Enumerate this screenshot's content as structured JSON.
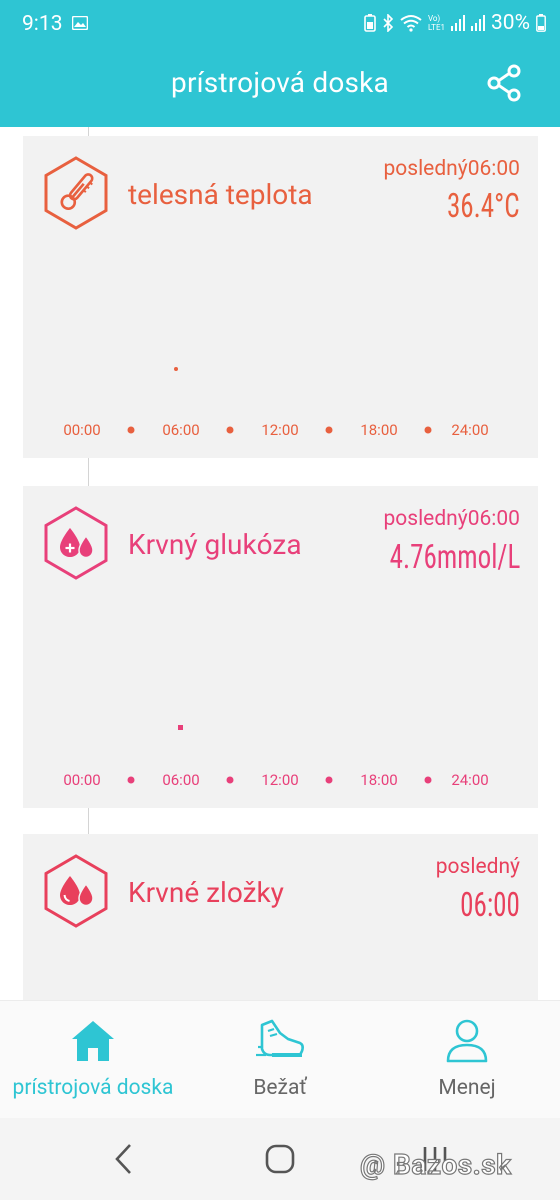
{
  "status": {
    "time": "9:13",
    "battery": "30%",
    "network_label_top": "Vo)",
    "network_label_bottom": "LTE1"
  },
  "appbar": {
    "title": "prístrojová doska",
    "share_icon": "share-icon"
  },
  "cards": [
    {
      "title": "telesná teplota",
      "last_label": "posledný06:00",
      "value": "36.4°C",
      "icon": "thermometer-icon",
      "color": "#e8603f",
      "axis_ticks": [
        "00:00",
        "06:00",
        "12:00",
        "18:00",
        "24:00"
      ]
    },
    {
      "title": "Krvný glukóza",
      "last_label": "posledný06:00",
      "value": "4.76mmol/L",
      "icon": "blood-drops-icon",
      "color": "#e8407a",
      "axis_ticks": [
        "00:00",
        "06:00",
        "12:00",
        "18:00",
        "24:00"
      ]
    },
    {
      "title": "Krvné zložky",
      "last_label": "posledný",
      "value": "06:00",
      "icon": "blood-drops-icon",
      "color": "#e8405c"
    }
  ],
  "bottom_nav": [
    {
      "label": "prístrojová doska",
      "icon": "home-icon",
      "active": true
    },
    {
      "label": "Bežať",
      "icon": "running-shoe-icon",
      "active": false
    },
    {
      "label": "Menej",
      "icon": "person-icon",
      "active": false
    }
  ],
  "colors": {
    "accent": "#2ec5d3",
    "inactive": "#666666"
  },
  "watermark": "@ Bazos.sk"
}
